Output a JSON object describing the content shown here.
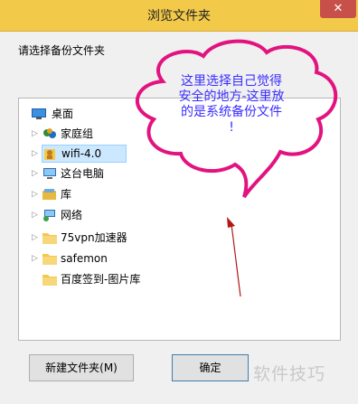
{
  "window": {
    "title": "浏览文件夹",
    "close_glyph": "✕"
  },
  "prompt": "请选择备份文件夹",
  "tree": {
    "items": [
      {
        "label": "桌面",
        "icon": "desktop-icon",
        "has_expander": false
      },
      {
        "label": "家庭组",
        "icon": "homegroup-icon",
        "has_expander": true
      },
      {
        "label": "wifi-4.0",
        "icon": "user-folder-icon",
        "has_expander": true,
        "selected": true
      },
      {
        "label": "这台电脑",
        "icon": "computer-icon",
        "has_expander": true
      },
      {
        "label": "库",
        "icon": "library-icon",
        "has_expander": true
      },
      {
        "label": "网络",
        "icon": "network-icon",
        "has_expander": true
      },
      {
        "label": "75vpn加速器",
        "icon": "folder-icon",
        "has_expander": true
      },
      {
        "label": "safemon",
        "icon": "folder-icon",
        "has_expander": true
      },
      {
        "label": "百度签到-图片库",
        "icon": "folder-icon",
        "has_expander": false
      }
    ]
  },
  "buttons": {
    "new_folder": "新建文件夹(M)",
    "ok": "确定"
  },
  "annotation": {
    "lines": [
      "这里选择自己觉得",
      "安全的地方-这里放",
      "的是系统备份文件",
      "!"
    ],
    "bubble_color": "#e2137f",
    "text_color": "#3a2dff"
  },
  "watermark": "软件技巧",
  "colors": {
    "titlebar": "#f3c94a",
    "close": "#c7504a",
    "selection": "#cce8ff"
  }
}
